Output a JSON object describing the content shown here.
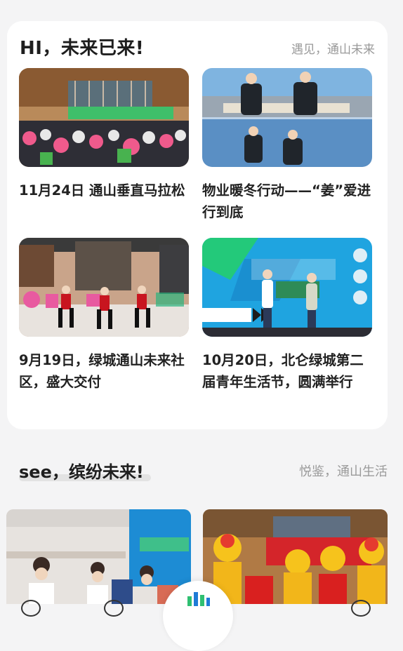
{
  "card": {
    "title": "HI，未来已来!",
    "subtitle": "遇见，通山未来",
    "items": [
      {
        "caption": "11月24日 通山垂直马拉松"
      },
      {
        "caption": "物业暖冬行动——“姜”爱进行到底"
      },
      {
        "caption": "9月19日，绿城通山未来社区，盛大交付"
      },
      {
        "caption": "10月20日，北仑绿城第二届青年生活节，圆满举行"
      }
    ]
  },
  "section2": {
    "title": "see，缤纷未来!",
    "subtitle": "悦鉴，通山生活"
  },
  "colors": {
    "card_bg": "#ffffff",
    "page_bg": "#f4f4f5",
    "muted_text": "#999999",
    "accent_green": "#2fbf71",
    "accent_blue": "#1f7bd6"
  }
}
